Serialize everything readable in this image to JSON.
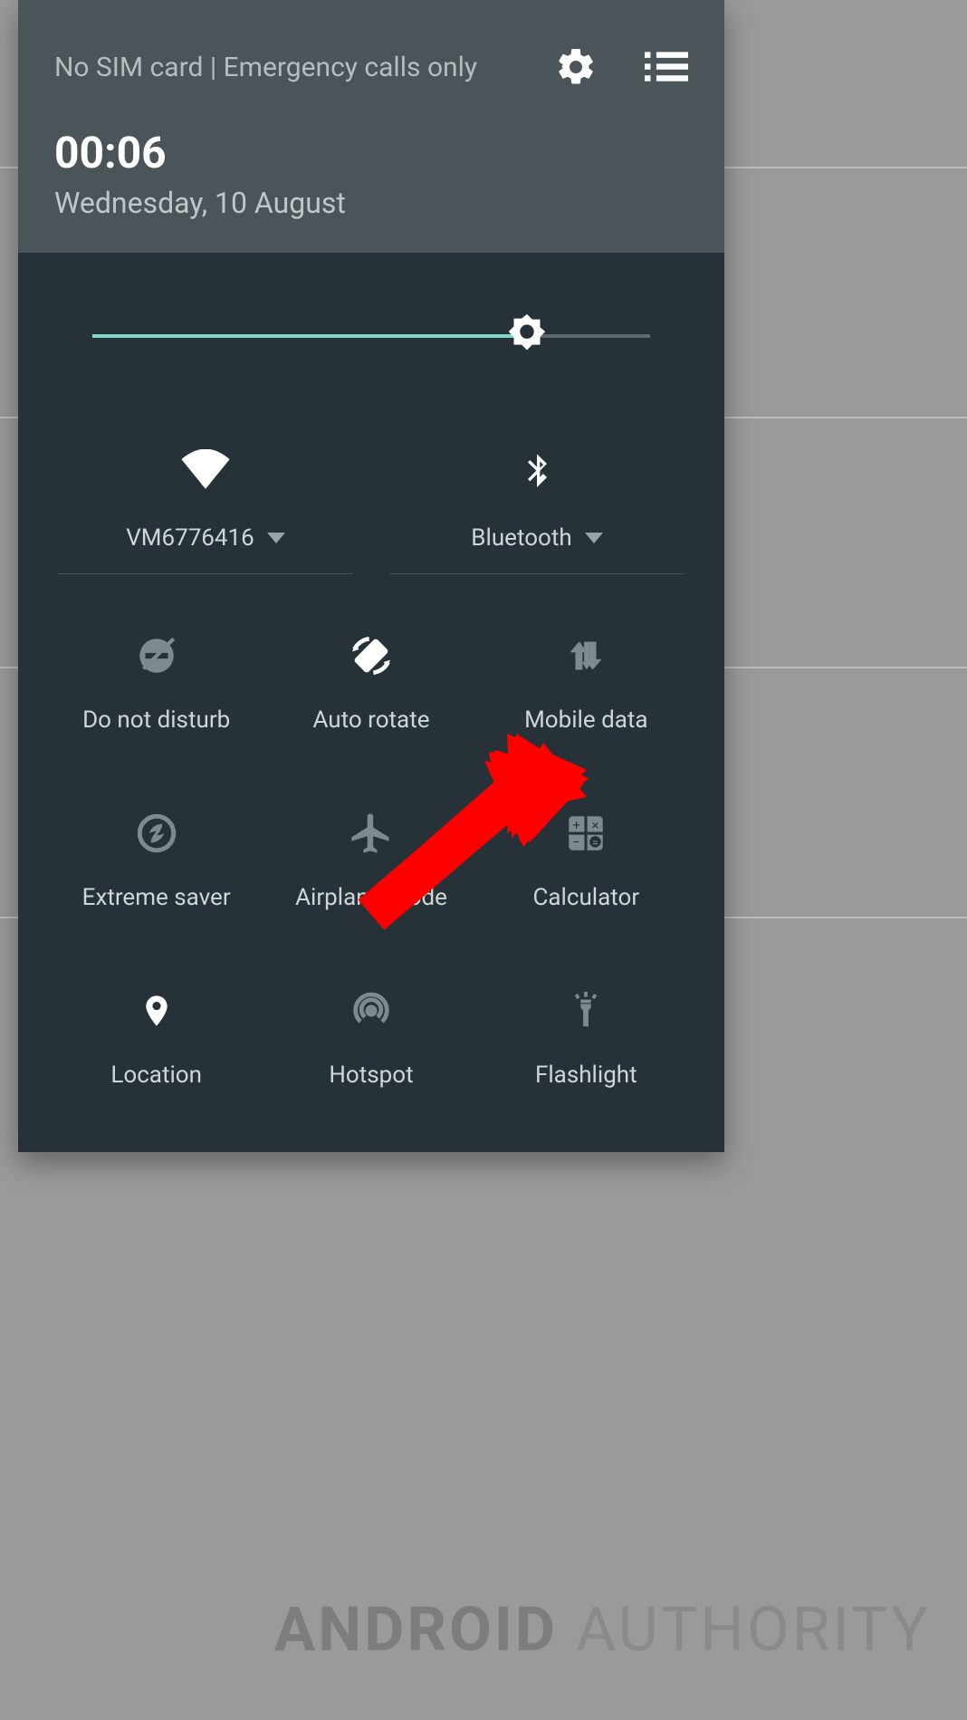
{
  "header": {
    "status_text": "No SIM card | Emergency calls only",
    "time": "00:06",
    "date": "Wednesday, 10 August"
  },
  "brightness": {
    "percent": 78
  },
  "top_toggles": {
    "wifi": {
      "label": "VM6776416"
    },
    "bluetooth": {
      "label": "Bluetooth"
    }
  },
  "tiles": [
    {
      "id": "dnd",
      "label": "Do not disturb",
      "active": false
    },
    {
      "id": "autorotate",
      "label": "Auto rotate",
      "active": true
    },
    {
      "id": "mobiledata",
      "label": "Mobile data",
      "active": false
    },
    {
      "id": "extremesaver",
      "label": "Extreme saver",
      "active": false
    },
    {
      "id": "airplane",
      "label": "Airplane mode",
      "active": false
    },
    {
      "id": "calculator",
      "label": "Calculator",
      "active": false
    },
    {
      "id": "location",
      "label": "Location",
      "active": true
    },
    {
      "id": "hotspot",
      "label": "Hotspot",
      "active": false
    },
    {
      "id": "flashlight",
      "label": "Flashlight",
      "active": false
    }
  ],
  "watermark": {
    "a": "ANDROID",
    "b": "AUTHORITY"
  }
}
